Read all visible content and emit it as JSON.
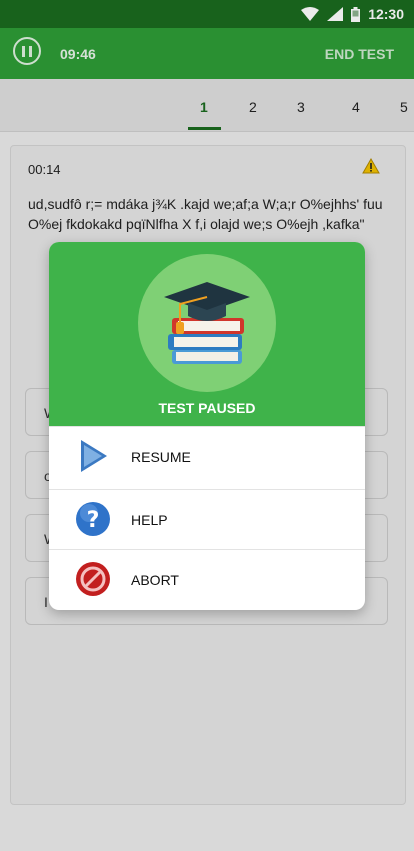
{
  "status_bar": {
    "time": "12:30"
  },
  "app_bar": {
    "timer": "09:46",
    "end_test_label": "END TEST"
  },
  "question_nav": {
    "numbers": [
      "1",
      "2",
      "3",
      "4",
      "5"
    ],
    "active": "1"
  },
  "question": {
    "time": "00:14",
    "text": "ud,sudfô r;= mdáka j¾K .kajd we;af;a W;a;r O%ejhhs' fuu O%ej fkdokakd pqïNlfha X f,i olajd we;s O%ejh ,kafka\""
  },
  "options": [
    {
      "text": "W"
    },
    {
      "text": "o"
    },
    {
      "text": "W"
    },
    {
      "text": "I"
    }
  ],
  "dialog": {
    "title": "TEST PAUSED",
    "items": [
      {
        "label": "RESUME",
        "icon": "play-icon"
      },
      {
        "label": "HELP",
        "icon": "help-icon"
      },
      {
        "label": "ABORT",
        "icon": "abort-icon"
      }
    ]
  },
  "colors": {
    "status_bar": "#1b6b1f",
    "app_bar": "#2e9d37",
    "dialog_header": "#3fb34a",
    "accent": "#1b6b1f"
  }
}
